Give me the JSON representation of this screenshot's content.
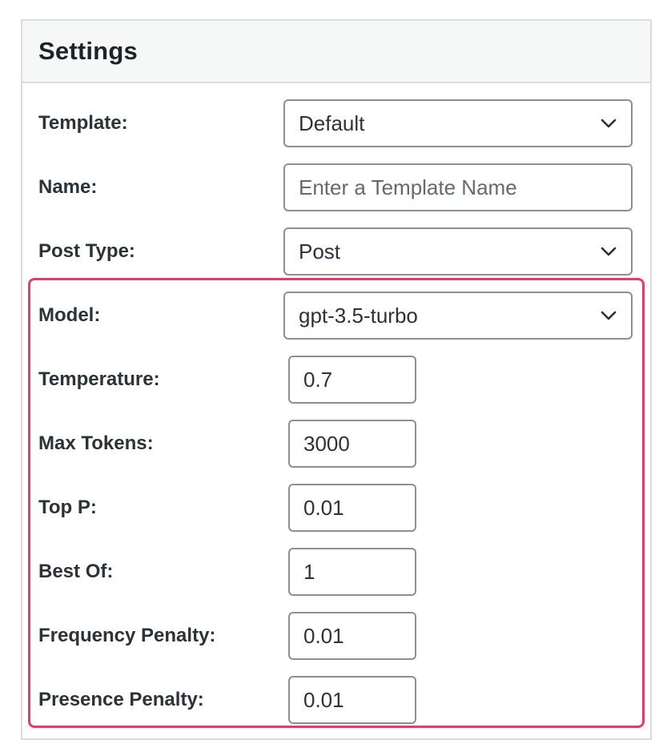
{
  "panel": {
    "title": "Settings"
  },
  "fields": {
    "template": {
      "label": "Template:",
      "value": "Default"
    },
    "name": {
      "label": "Name:",
      "value": "",
      "placeholder": "Enter a Template Name"
    },
    "post_type": {
      "label": "Post Type:",
      "value": "Post"
    },
    "model": {
      "label": "Model:",
      "value": "gpt-3.5-turbo"
    },
    "temperature": {
      "label": "Temperature:",
      "value": "0.7"
    },
    "max_tokens": {
      "label": "Max Tokens:",
      "value": "3000"
    },
    "top_p": {
      "label": "Top P:",
      "value": "0.01"
    },
    "best_of": {
      "label": "Best Of:",
      "value": "1"
    },
    "frequency_penalty": {
      "label": "Frequency Penalty:",
      "value": "0.01"
    },
    "presence_penalty": {
      "label": "Presence Penalty:",
      "value": "0.01"
    }
  },
  "colors": {
    "highlight_border": "#e63d67",
    "input_border": "#8c8f94",
    "header_bg": "#f6f7f7"
  },
  "icons": {
    "dropdown": "chevron-down-icon"
  }
}
